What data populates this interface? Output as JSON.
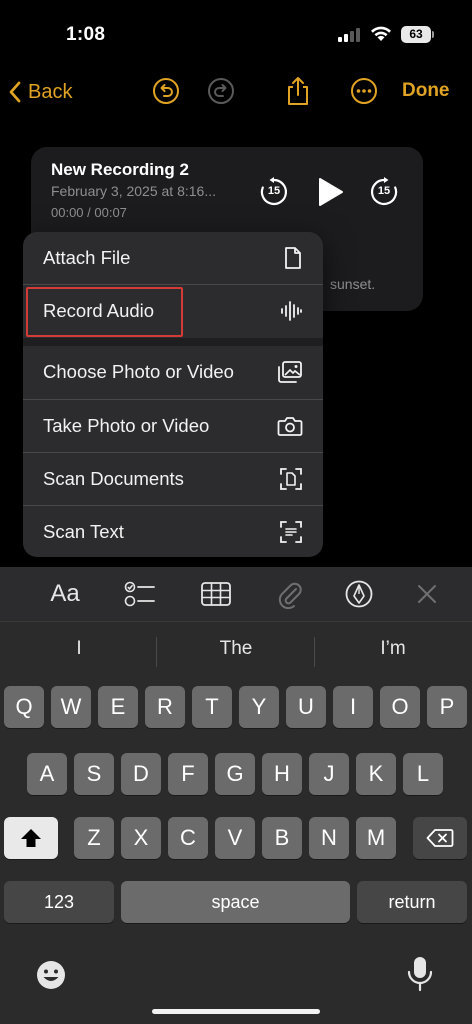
{
  "status": {
    "time": "1:08",
    "battery": "63"
  },
  "nav": {
    "back_label": "Back",
    "done_label": "Done"
  },
  "recording": {
    "title": "New Recording 2",
    "date": "February 3, 2025 at 8:16...",
    "time": "00:00 / 00:07",
    "skip_back": "15",
    "skip_forward": "15",
    "note_tail": "sunset."
  },
  "menu": {
    "items": [
      {
        "label": "Attach File",
        "icon": "document-icon"
      },
      {
        "label": "Record Audio",
        "icon": "waveform-icon"
      },
      {
        "label": "Choose Photo or Video",
        "icon": "photo-library-icon"
      },
      {
        "label": "Take Photo or Video",
        "icon": "camera-icon"
      },
      {
        "label": "Scan Documents",
        "icon": "scan-document-icon"
      },
      {
        "label": "Scan Text",
        "icon": "scan-text-icon"
      }
    ]
  },
  "toolbar": {
    "format_label": "Aa"
  },
  "suggestions": [
    "I",
    "The",
    "I’m"
  ],
  "keyboard": {
    "row1": [
      "Q",
      "W",
      "E",
      "R",
      "T",
      "Y",
      "U",
      "I",
      "O",
      "P"
    ],
    "row2": [
      "A",
      "S",
      "D",
      "F",
      "G",
      "H",
      "J",
      "K",
      "L"
    ],
    "row3": [
      "Z",
      "X",
      "C",
      "V",
      "B",
      "N",
      "M"
    ],
    "numbers_label": "123",
    "space_label": "space",
    "return_label": "return"
  },
  "colors": {
    "accent": "#e0a324",
    "highlight": "#d43a36"
  }
}
